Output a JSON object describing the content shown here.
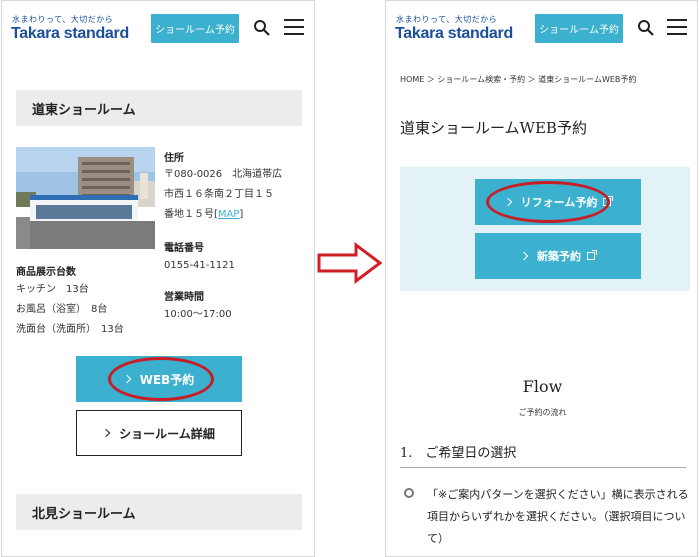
{
  "header": {
    "tagline": "水まわりって、大切だから",
    "logo": "Takara standard",
    "showroom_button": "ショールーム予約"
  },
  "left": {
    "section1_title": "道東ショールーム",
    "address_label": "住所",
    "address_lines": [
      "〒080-0026　北海道帯広",
      "市西１６条南２丁目１５",
      "番地１５号"
    ],
    "map_link": "MAP",
    "phone_label": "電話番号",
    "phone": "0155-41-1121",
    "hours_label": "営業時間",
    "hours": "10:00〜17:00",
    "display_label": "商品展示台数",
    "display_items": [
      "キッチン　13台",
      "お風呂（浴室）　8台",
      "洗面台（洗面所）　13台"
    ],
    "web_button": "WEB予約",
    "detail_button": "ショールーム詳細",
    "section2_title": "北見ショールーム"
  },
  "right": {
    "breadcrumb": "HOME ＞ ショールーム検索・予約 ＞ 道東ショールームWEB予約",
    "page_title": "道東ショールームWEB予約",
    "reform_button": "リフォーム予約",
    "new_build_button": "新築予約",
    "flow_title": "Flow",
    "flow_subtitle": "ご予約の流れ",
    "step1_heading": "1.　ご希望日の選択",
    "step1_text": "「※ご案内パターンを選択ください」横に表示される項目からいずれかを選択ください。（選択項目について）"
  },
  "colors": {
    "accent": "#3bb0cf",
    "brand": "#1a4f9c",
    "highlight": "#c81d25"
  }
}
